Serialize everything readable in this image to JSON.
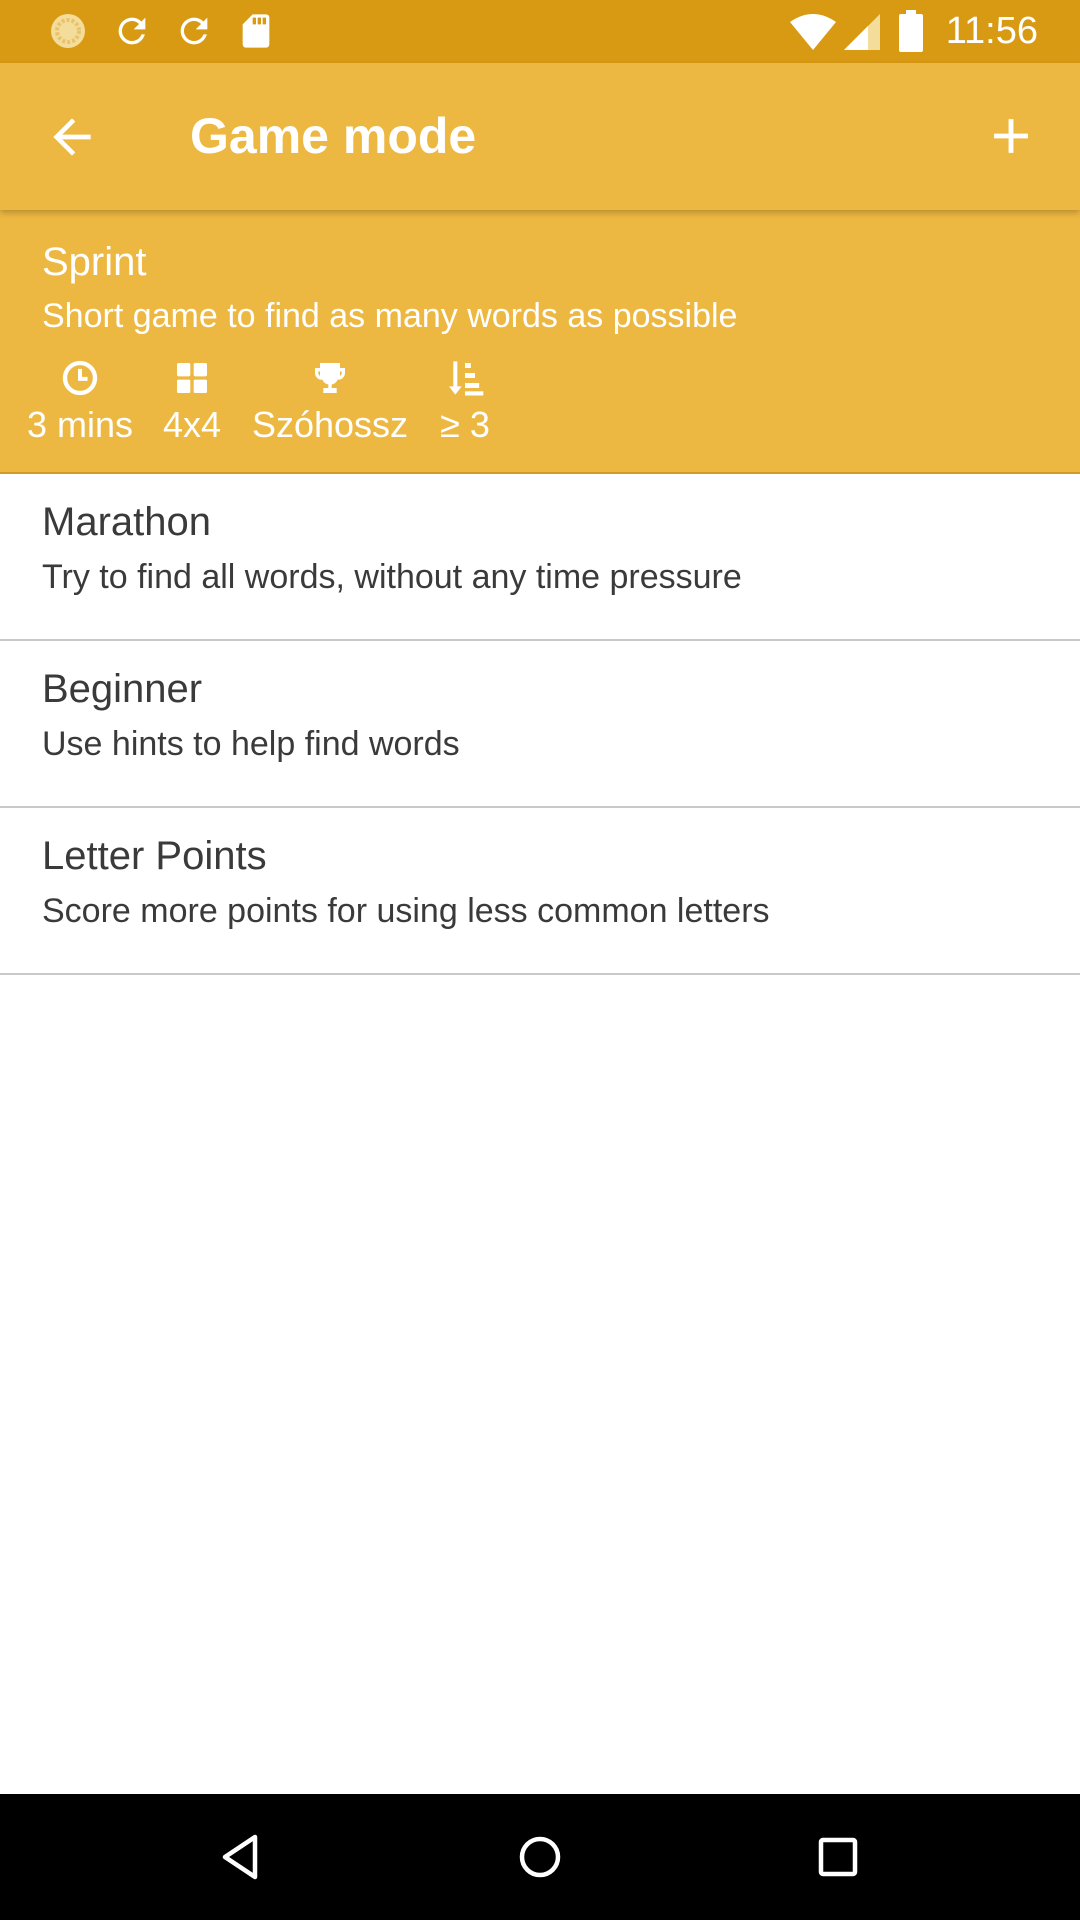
{
  "status_bar": {
    "time": "11:56",
    "icons": [
      "sync-progress-icon",
      "refresh-icon",
      "refresh-icon",
      "sd-card-icon",
      "wifi-icon",
      "signal-icon",
      "battery-icon"
    ]
  },
  "app_bar": {
    "title": "Game mode",
    "back_icon": "arrow-back-icon",
    "add_icon": "plus-icon"
  },
  "modes": [
    {
      "name": "Sprint",
      "description": "Short game to find as many words as possible",
      "selected": true,
      "stats": [
        {
          "icon": "clock-icon",
          "value": "3 mins"
        },
        {
          "icon": "grid-icon",
          "value": "4x4"
        },
        {
          "icon": "trophy-icon",
          "value": "Szóhossz"
        },
        {
          "icon": "sort-icon",
          "value": "≥ 3"
        }
      ]
    },
    {
      "name": "Marathon",
      "description": "Try to find all words, without any time pressure",
      "selected": false
    },
    {
      "name": "Beginner",
      "description": "Use hints to help find words",
      "selected": false
    },
    {
      "name": "Letter Points",
      "description": "Score more points for using less common letters",
      "selected": false
    }
  ],
  "nav_bar": {
    "icons": [
      "nav-back-icon",
      "nav-home-icon",
      "nav-recents-icon"
    ]
  },
  "colors": {
    "status_bar": "#d99a13",
    "app_bar": "#edb841",
    "selected_item": "#edb841",
    "text": "#3a3a3a",
    "divider": "#c9c9c9"
  }
}
